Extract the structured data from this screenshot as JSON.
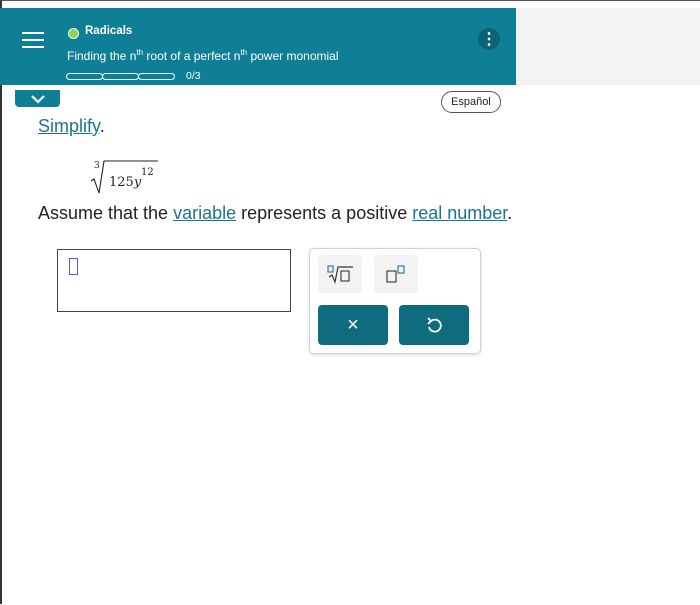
{
  "header": {
    "topic": "Radicals",
    "title_pre": "Finding the n",
    "sup1": "th",
    "title_mid": " root of a perfect n",
    "sup2": "th",
    "title_post": " power monomial",
    "progress_text": "0/3",
    "progress_segments": 3,
    "progress_completed": 0
  },
  "language_button": "Español",
  "problem": {
    "instruction": "Simplify",
    "period": ".",
    "radical_index": "3",
    "radicand_coef": "125",
    "radicand_var": "y",
    "radicand_exp": "12",
    "assume_pre": "Assume that the ",
    "assume_link1": "variable",
    "assume_mid": " represents a positive ",
    "assume_link2": "real number",
    "assume_post": "."
  },
  "tools": {
    "clear_symbol": "×",
    "undo_symbol": "↺"
  },
  "colors": {
    "header_bg": "#0e7f96",
    "button_bg": "#0e6c7e",
    "link": "#1c7391",
    "status_dot": "#8fd14f"
  }
}
